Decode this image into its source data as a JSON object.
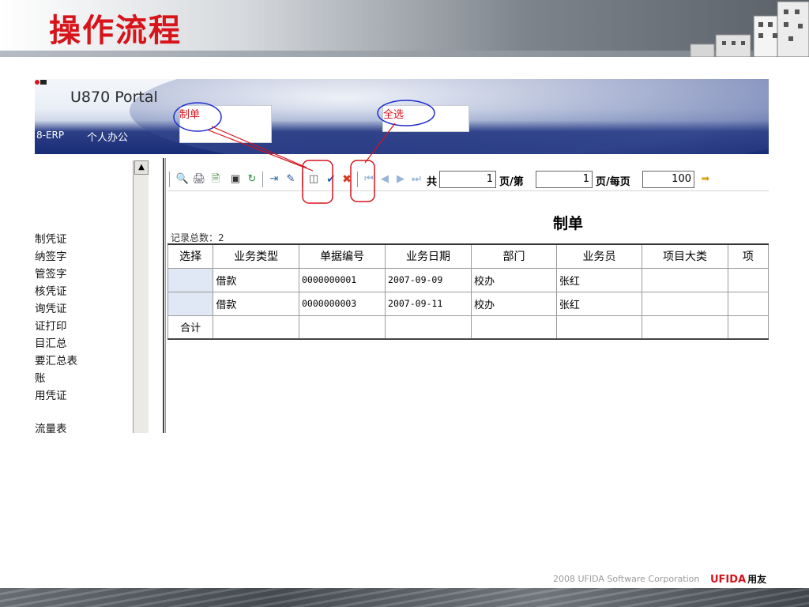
{
  "slide": {
    "title": "操作流程",
    "footer_text": "2008 UFIDA Software Corporation",
    "footer_brand": "UFIDA",
    "footer_brand_cn": "用友"
  },
  "portal": {
    "title": "U870 Portal",
    "erp_tab": "8-ERP",
    "personal_office": "个人办公"
  },
  "annotations": {
    "make_voucher": "制单",
    "select_all": "全选"
  },
  "nav": {
    "items": [
      "制凭证",
      "纳签字",
      "管签字",
      "核凭证",
      "询凭证",
      "证打印",
      "目汇总",
      "要汇总表",
      "账",
      "用凭证",
      "流量表"
    ]
  },
  "toolbar": {
    "total_label": "共",
    "page_label": "页/第",
    "per_page_label": "页/每页",
    "total_pages": "1",
    "current_page": "1",
    "per_page": "100",
    "icons": [
      "preview-icon",
      "print-icon",
      "export-icon",
      "find-icon",
      "refresh-icon",
      "import-icon",
      "make-voucher-icon",
      "query-icon",
      "select-all-icon",
      "deselect-all-icon",
      "first-page-icon",
      "prev-page-icon",
      "next-page-icon",
      "last-page-icon",
      "exit-icon"
    ]
  },
  "document": {
    "title": "制单",
    "record_count_label": "记录总数：2"
  },
  "grid": {
    "columns": [
      "选择",
      "业务类型",
      "单据编号",
      "业务日期",
      "部门",
      "业务员",
      "项目大类",
      "项"
    ],
    "rows": [
      {
        "select": "",
        "type": "借款",
        "number": "0000000001",
        "date": "2007-09-09",
        "dept": "校办",
        "staff": "张红",
        "project": "",
        "extra": ""
      },
      {
        "select": "",
        "type": "借款",
        "number": "0000000003",
        "date": "2007-09-11",
        "dept": "校办",
        "staff": "张红",
        "project": "",
        "extra": ""
      }
    ],
    "total_label": "合计"
  },
  "colors": {
    "title_red": "#d8141b",
    "annotation_red": "#d6121c",
    "annotation_blue": "#1f2fd0",
    "banner_blue": "#1a2c78"
  }
}
